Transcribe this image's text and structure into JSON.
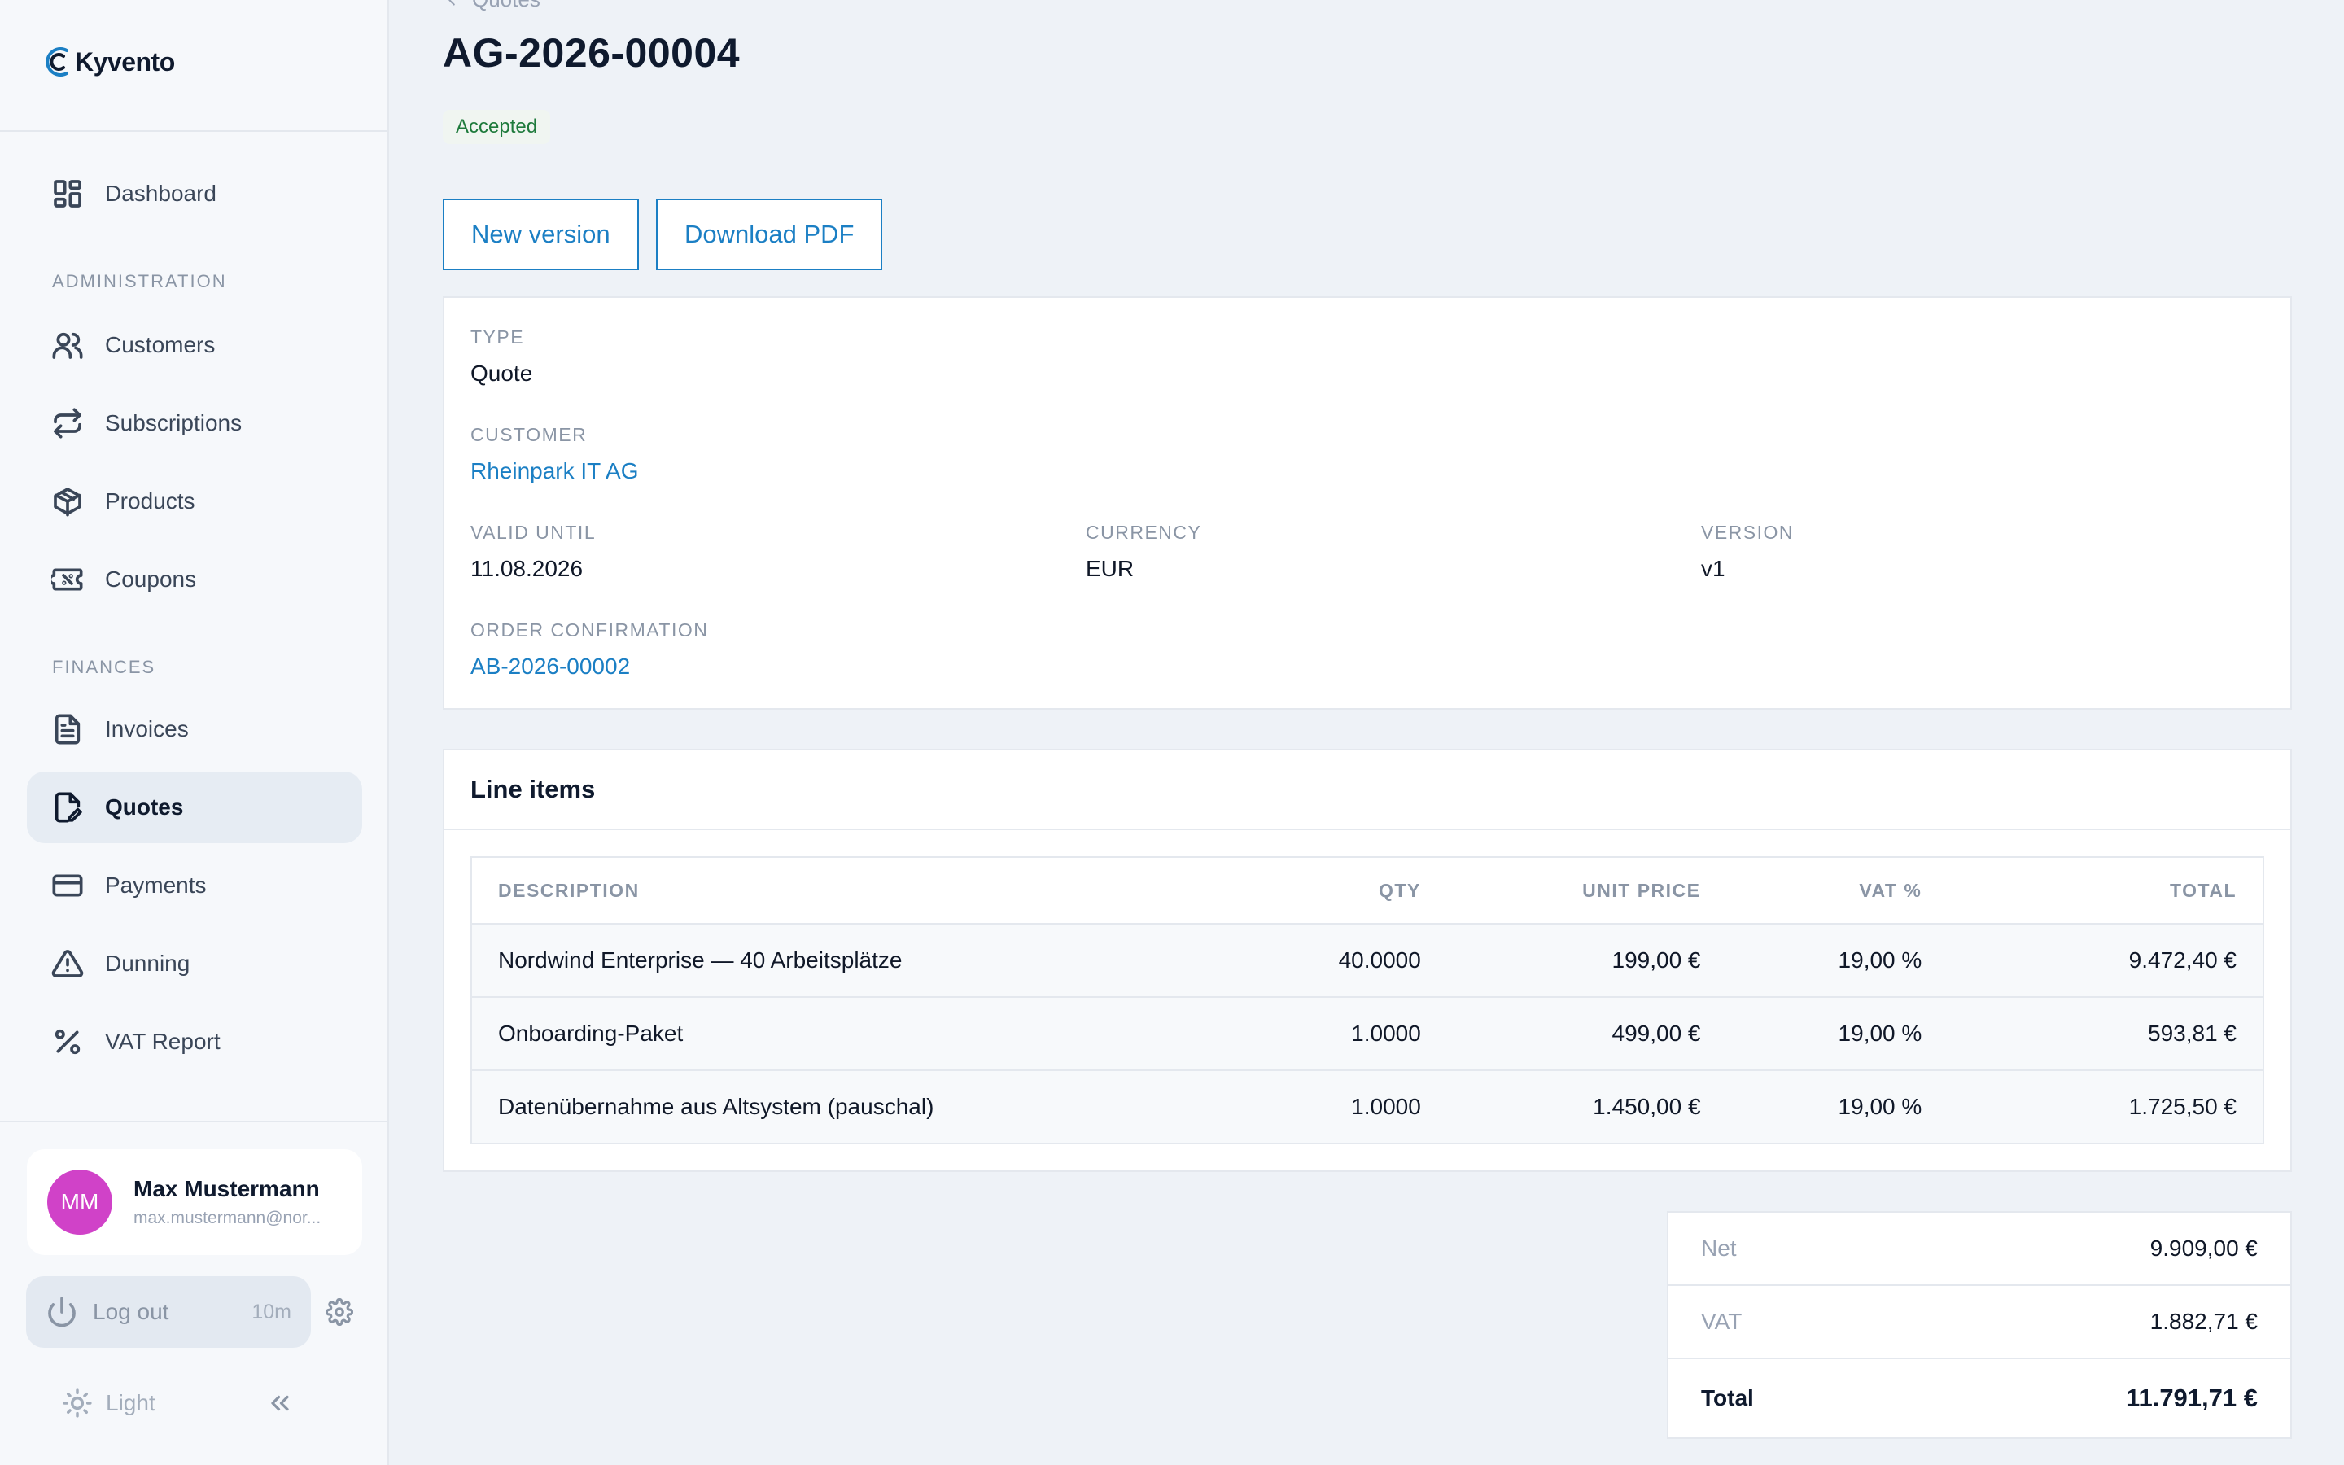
{
  "brand": {
    "name": "Kyvento",
    "accent": "#1b7fc4"
  },
  "sidebar": {
    "dashboard": "Dashboard",
    "administration_label": "ADMINISTRATION",
    "administration": [
      "Customers",
      "Subscriptions",
      "Products",
      "Coupons"
    ],
    "finances_label": "FINANCES",
    "finances": [
      "Invoices",
      "Quotes",
      "Payments",
      "Dunning",
      "VAT Report"
    ],
    "active": "Quotes",
    "user": {
      "initials": "MM",
      "name": "Max Mustermann",
      "email": "max.mustermann@nor..."
    },
    "logout": {
      "label": "Log out",
      "timer": "10m"
    },
    "theme": "Light"
  },
  "header": {
    "breadcrumb": "Quotes",
    "title": "AG-2026-00004",
    "status": "Accepted",
    "status_color": "#1e7a3c"
  },
  "actions": {
    "new_version": "New version",
    "download_pdf": "Download PDF"
  },
  "details": {
    "type_label": "TYPE",
    "type": "Quote",
    "customer_label": "CUSTOMER",
    "customer": "Rheinpark IT AG",
    "valid_until_label": "VALID UNTIL",
    "valid_until": "11.08.2026",
    "currency_label": "CURRENCY",
    "currency": "EUR",
    "version_label": "VERSION",
    "version": "v1",
    "order_confirmation_label": "ORDER CONFIRMATION",
    "order_confirmation": "AB-2026-00002"
  },
  "line_items": {
    "title": "Line items",
    "columns": [
      "DESCRIPTION",
      "QTY",
      "UNIT PRICE",
      "VAT %",
      "TOTAL"
    ],
    "rows": [
      [
        "Nordwind Enterprise — 40 Arbeitsplätze",
        "40.0000",
        "199,00 €",
        "19,00 %",
        "9.472,40 €"
      ],
      [
        "Onboarding-Paket",
        "1.0000",
        "499,00 €",
        "19,00 %",
        "593,81 €"
      ],
      [
        "Datenübernahme aus Altsystem (pauschal)",
        "1.0000",
        "1.450,00 €",
        "19,00 %",
        "1.725,50 €"
      ]
    ]
  },
  "totals": {
    "net_label": "Net",
    "net": "9.909,00 €",
    "vat_label": "VAT",
    "vat": "1.882,71 €",
    "total_label": "Total",
    "total": "11.791,71 €"
  }
}
